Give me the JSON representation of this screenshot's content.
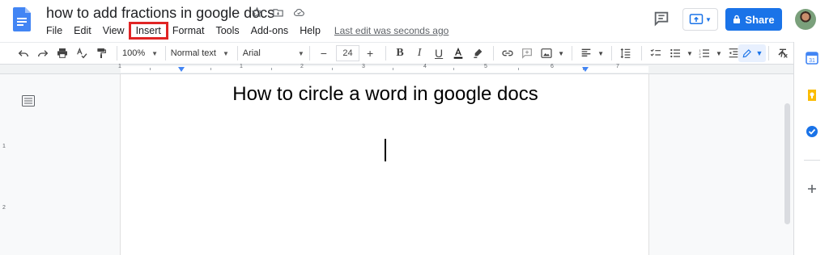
{
  "document": {
    "title": "how to add fractions in google docs",
    "heading": "How to circle a word in google docs"
  },
  "menu": {
    "items": [
      "File",
      "Edit",
      "View",
      "Insert",
      "Format",
      "Tools",
      "Add-ons",
      "Help"
    ],
    "highlighted": "Insert",
    "last_edit": "Last edit was seconds ago"
  },
  "header": {
    "share_label": "Share"
  },
  "toolbar": {
    "zoom": "100%",
    "style": "Normal text",
    "font": "Arial",
    "font_size": "24",
    "minus": "−",
    "plus": "+",
    "bold": "B",
    "italic": "I",
    "underline": "U"
  },
  "ruler": {
    "horizontal_labels": [
      "1",
      "1",
      "2",
      "3",
      "4",
      "5",
      "6",
      "7"
    ],
    "vertical_labels": [
      "1",
      "2"
    ]
  },
  "colors": {
    "accent": "#1a73e8",
    "highlight_box": "#e02424",
    "docs_blue": "#4285f4"
  },
  "icons": {
    "side_panel": [
      "calendar-icon",
      "keep-icon",
      "tasks-icon",
      "add-icon"
    ]
  }
}
